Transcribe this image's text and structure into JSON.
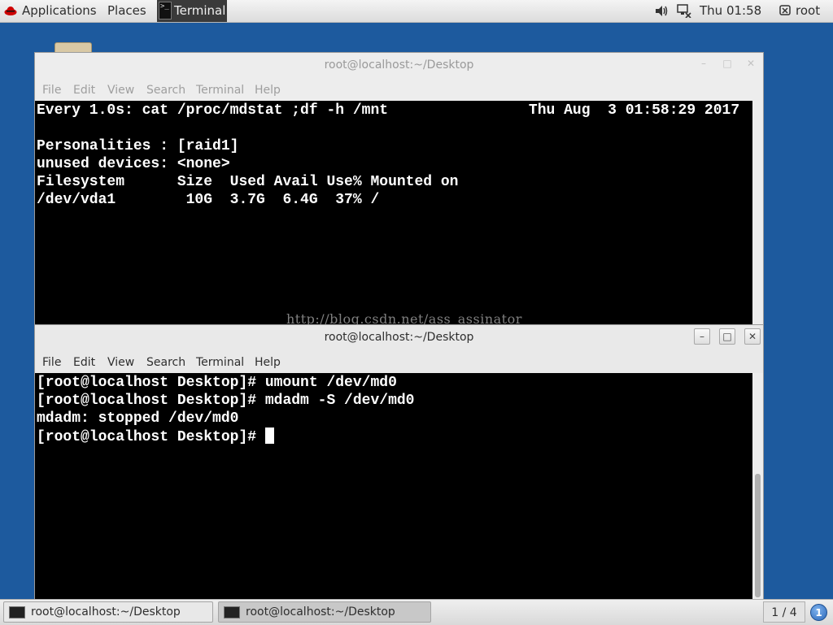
{
  "top_panel": {
    "applications": "Applications",
    "places": "Places",
    "terminal": "Terminal",
    "clock": "Thu 01:58",
    "user": "root"
  },
  "window_back": {
    "title": "root@localhost:~/Desktop",
    "menu": [
      "File",
      "Edit",
      "View",
      "Search",
      "Terminal",
      "Help"
    ],
    "lines": [
      "Every 1.0s: cat /proc/mdstat ;df -h /mnt                Thu Aug  3 01:58:29 2017",
      "",
      "Personalities : [raid1]",
      "unused devices: <none>",
      "Filesystem      Size  Used Avail Use% Mounted on",
      "/dev/vda1        10G  3.7G  6.4G  37% /"
    ]
  },
  "window_front": {
    "title": "root@localhost:~/Desktop",
    "menu": [
      "File",
      "Edit",
      "View",
      "Search",
      "Terminal",
      "Help"
    ],
    "lines": [
      "[root@localhost Desktop]# umount /dev/md0",
      "[root@localhost Desktop]# mdadm -S /dev/md0",
      "mdadm: stopped /dev/md0"
    ],
    "prompt": "[root@localhost Desktop]# "
  },
  "watermark": "http://blog.csdn.net/ass_assinator",
  "taskbar": {
    "tasks": [
      "root@localhost:~/Desktop",
      "root@localhost:~/Desktop"
    ],
    "workspace": "1 / 4",
    "notifications": "1"
  },
  "colors": {
    "desktop": "#1d5a9e",
    "terminal_bg": "#000000",
    "terminal_fg": "#ffffff"
  }
}
